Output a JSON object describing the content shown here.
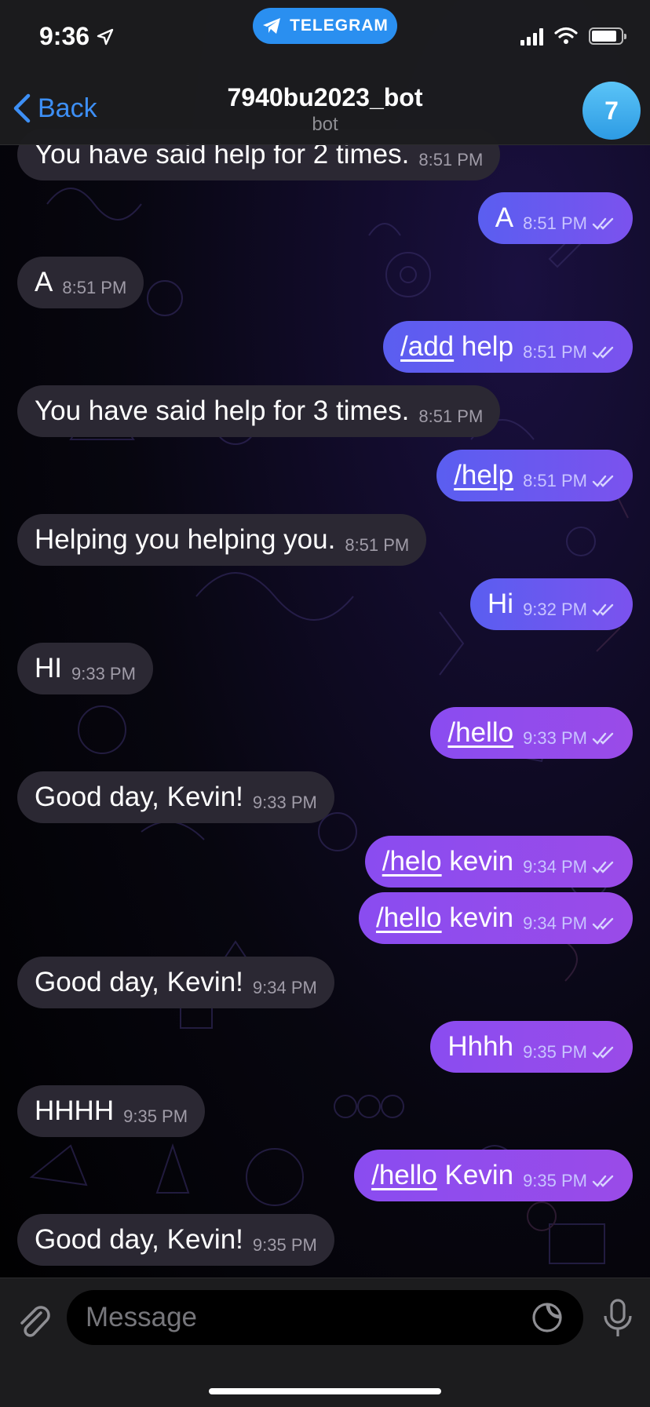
{
  "status_bar": {
    "time": "9:36",
    "app_pill": "TELEGRAM"
  },
  "header": {
    "back_label": "Back",
    "title": "7940bu2023_bot",
    "subtitle": "bot",
    "avatar_letter": "7"
  },
  "composer": {
    "placeholder": "Message"
  },
  "messages": [
    {
      "dir": "in",
      "text": "You have said help for 2 times.",
      "time": "8:51 PM"
    },
    {
      "dir": "out",
      "text": "A",
      "time": "8:51 PM"
    },
    {
      "dir": "in",
      "text": "A",
      "time": "8:51 PM"
    },
    {
      "dir": "out",
      "cmd": "/add",
      "text": " help",
      "time": "8:51 PM"
    },
    {
      "dir": "in",
      "text": "You have said help for 3 times.",
      "time": "8:51 PM"
    },
    {
      "dir": "out",
      "cmd": "/help",
      "text": "",
      "time": "8:51 PM"
    },
    {
      "dir": "in",
      "text": "Helping you helping you.",
      "time": "8:51 PM"
    },
    {
      "dir": "out",
      "text": "Hi",
      "time": "9:32 PM"
    },
    {
      "dir": "in",
      "text": "HI",
      "time": "9:33 PM"
    },
    {
      "dir": "out",
      "cmd": "/hello",
      "text": "",
      "time": "9:33 PM"
    },
    {
      "dir": "in",
      "text": "Good day, Kevin!",
      "time": "9:33 PM"
    },
    {
      "dir": "out",
      "cmd": "/helo",
      "text": " kevin",
      "time": "9:34 PM"
    },
    {
      "dir": "out",
      "cmd": "/hello",
      "text": " kevin",
      "time": "9:34 PM"
    },
    {
      "dir": "in",
      "text": "Good day, Kevin!",
      "time": "9:34 PM"
    },
    {
      "dir": "out",
      "text": "Hhhh",
      "time": "9:35 PM"
    },
    {
      "dir": "in",
      "text": "HHHH",
      "time": "9:35 PM"
    },
    {
      "dir": "out",
      "cmd": "/hello",
      "text": " Kevin",
      "time": "9:35 PM"
    },
    {
      "dir": "in",
      "text": "Good day, Kevin!",
      "time": "9:35 PM"
    }
  ]
}
